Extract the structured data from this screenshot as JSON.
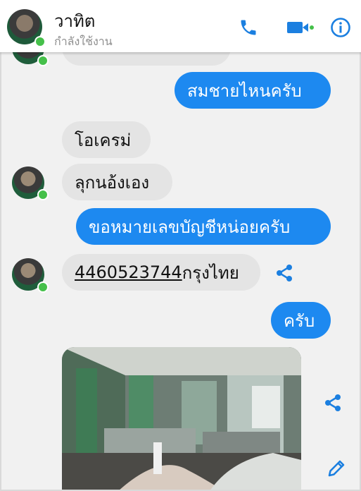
{
  "header": {
    "name": "วาทิต",
    "status": "กำลังใช้งาน"
  },
  "messages": [
    {
      "side": "out",
      "text": "สมชายไหนครับ"
    },
    {
      "side": "in",
      "text": "โอเครม่"
    },
    {
      "side": "in",
      "text": "ลุกนอ้งเอง"
    },
    {
      "side": "out",
      "text": "ขอหมายเลขบัญชีหน่อยครับ"
    },
    {
      "side": "in",
      "account": "4460523744",
      "bank": "กรุงไทย"
    },
    {
      "side": "out",
      "text": "ครับ"
    }
  ],
  "colors": {
    "outgoing": "#1d89f0",
    "incoming": "#e4e4e4",
    "online": "#45c04a",
    "accent": "#1b7fe0"
  },
  "icons": [
    "phone-icon",
    "video-call-icon",
    "info-icon",
    "share-icon",
    "edit-icon"
  ]
}
